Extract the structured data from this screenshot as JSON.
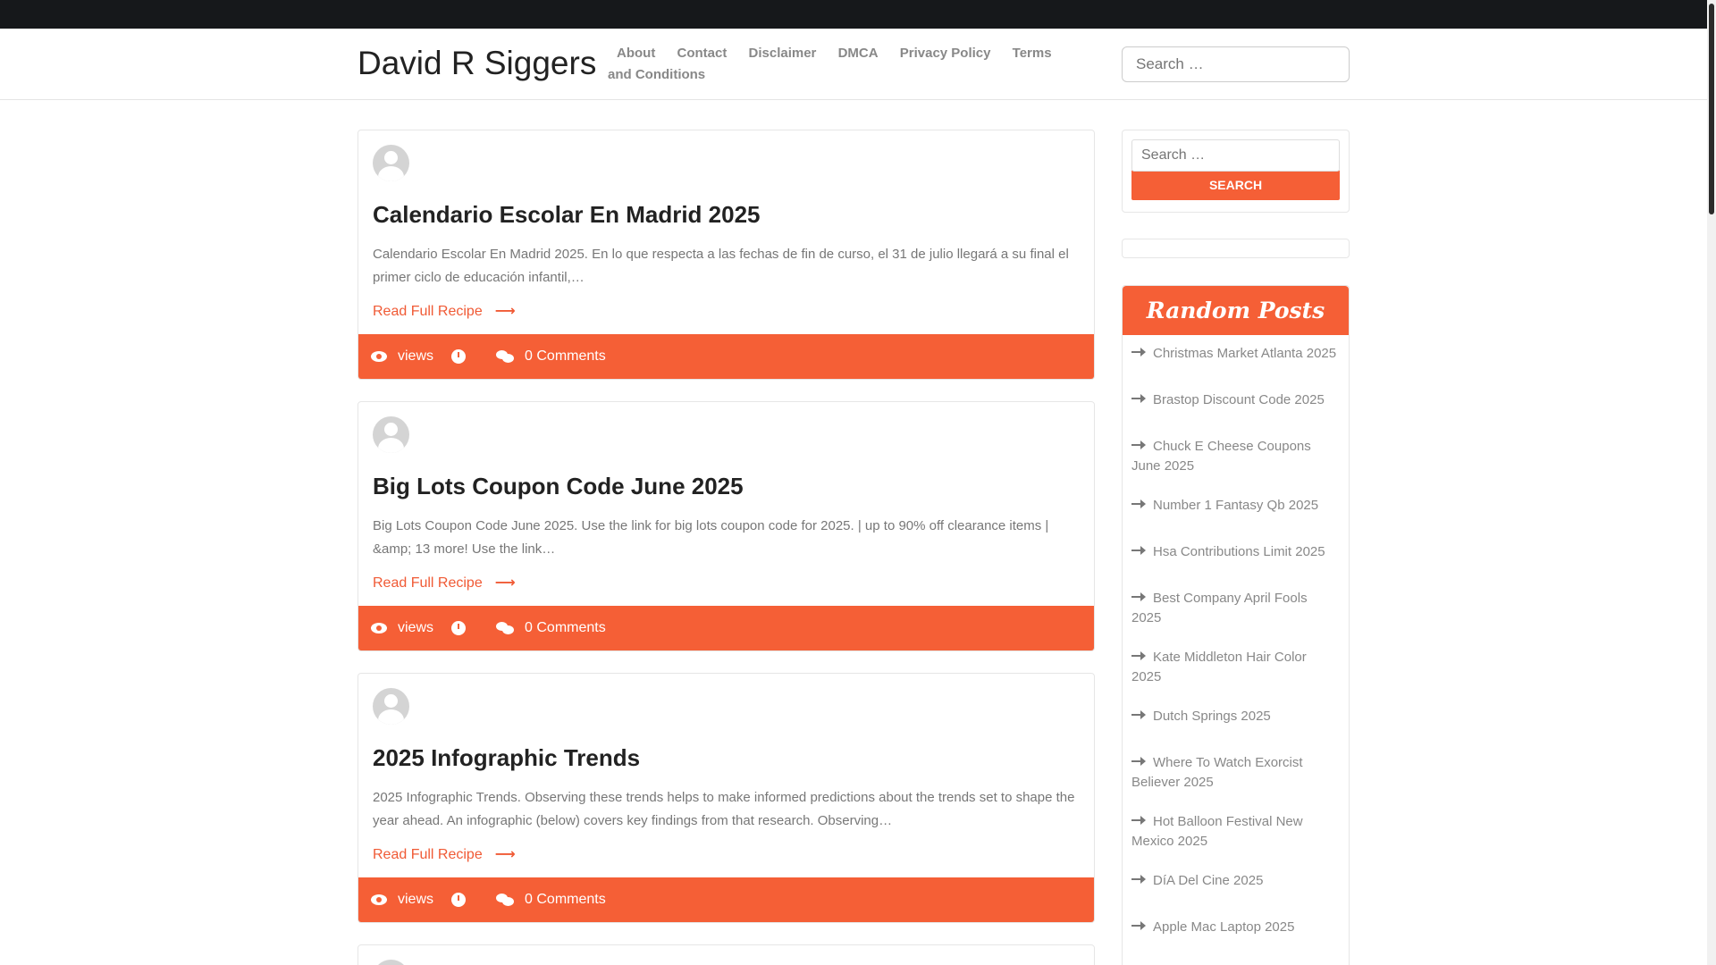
{
  "site": {
    "title": "David R Siggers"
  },
  "nav": {
    "items": [
      "About",
      "Contact",
      "Disclaimer",
      "DMCA",
      "Privacy Policy",
      "Terms and Conditions"
    ]
  },
  "header_search": {
    "placeholder": "Search …"
  },
  "posts": [
    {
      "title": "Calendario Escolar En Madrid 2025",
      "excerpt": "Calendario Escolar En Madrid 2025. En lo que respecta a las fechas de fin de curso, el 31 de julio llegará a su final el primer ciclo de educación infantil,…",
      "read_more": "Read Full Recipe",
      "views_label": "views",
      "comments_label": "0 Comments"
    },
    {
      "title": "Big Lots Coupon Code June 2025",
      "excerpt": "Big Lots Coupon Code June 2025. Use the link for big lots coupon code for 2025. | up to 90% off clearance items | &amp; 13 more! Use the link…",
      "read_more": "Read Full Recipe",
      "views_label": "views",
      "comments_label": "0 Comments"
    },
    {
      "title": "2025 Infographic Trends",
      "excerpt": "2025 Infographic Trends. Observing these trends helps to make informed predictions about the trends set to shape the year ahead. An infographic (below) covers key findings from that research. Observing…",
      "read_more": "Read Full Recipe",
      "views_label": "views",
      "comments_label": "0 Comments"
    }
  ],
  "sidebar": {
    "search": {
      "placeholder": "Search …",
      "button_label": "SEARCH"
    },
    "random_posts": {
      "title": "Random Posts",
      "items": [
        "Christmas Market Atlanta 2025",
        "Brastop Discount Code 2025",
        "Chuck E Cheese Coupons June 2025",
        "Number 1 Fantasy Qb 2025",
        "Hsa Contributions Limit 2025",
        "Best Company April Fools 2025",
        "Kate Middleton Hair Color 2025",
        "Dutch Springs 2025",
        "Where To Watch Exorcist Believer 2025",
        "Hot Balloon Festival New Mexico 2025",
        "DíA Del Cine 2025",
        "Apple Mac Laptop 2025"
      ]
    }
  },
  "colors": {
    "accent": "#f55f36",
    "topbar": "#16181b"
  }
}
